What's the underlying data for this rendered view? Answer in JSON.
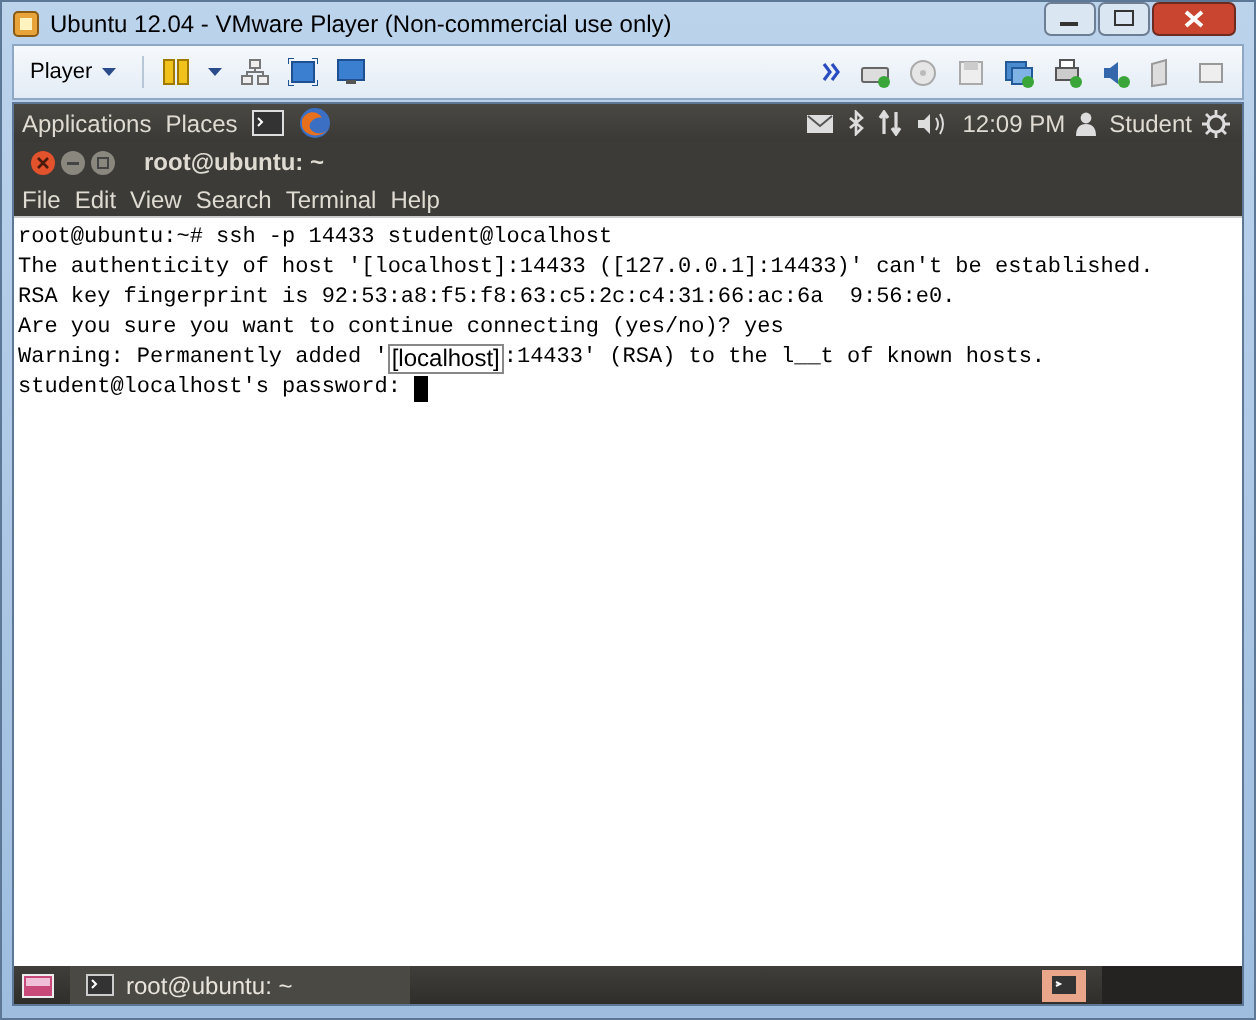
{
  "window": {
    "title": "Ubuntu 12.04 - VMware Player (Non-commercial use only)"
  },
  "toolbar": {
    "player_menu": "Player"
  },
  "top_panel": {
    "menus": [
      "Applications",
      "Places"
    ],
    "clock": "12:09 PM",
    "user": "Student"
  },
  "terminal": {
    "title": "root@ubuntu: ~",
    "menu": [
      "File",
      "Edit",
      "View",
      "Search",
      "Terminal",
      "Help"
    ],
    "lines": [
      {
        "kind": "text",
        "text": "root@ubuntu:~# ssh -p 14433 student@localhost"
      },
      {
        "kind": "text",
        "text": "The authenticity of host '[localhost]:14433 ([127.0.0.1]:14433)' can't be established."
      },
      {
        "kind": "text",
        "text": "RSA key fingerprint is 92:53:a8:f5:f8:63:c5:2c:c4:31:66:ac:6a  9:56:e0."
      },
      {
        "kind": "text",
        "text": "Are you sure you want to continue connecting (yes/no)? yes"
      },
      {
        "kind": "overlay",
        "before": "Warning: Permanently added '",
        "overlay": "[localhost]",
        "after": ":14433' (RSA) to the l__t of known hosts."
      },
      {
        "kind": "prompt",
        "text": "student@localhost's password: "
      }
    ]
  },
  "bottom_panel": {
    "task": "root@ubuntu: ~"
  }
}
